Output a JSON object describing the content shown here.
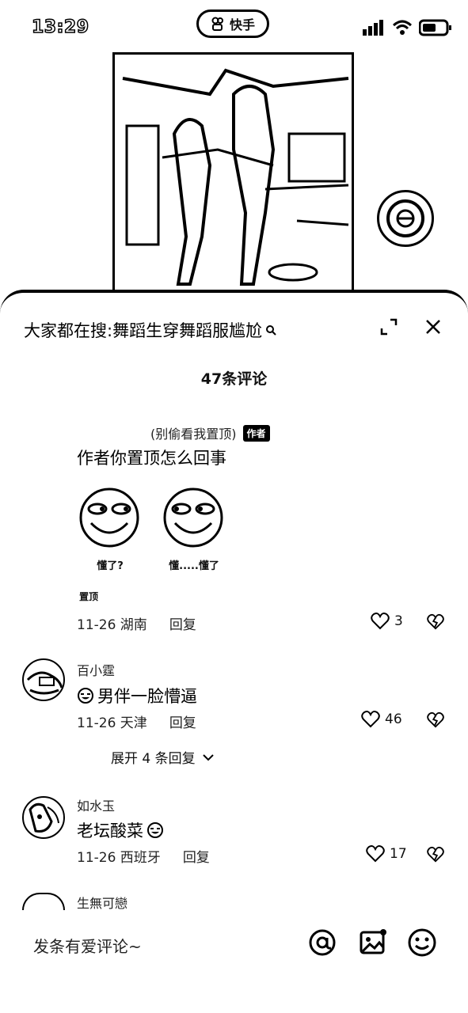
{
  "status_bar": {
    "time": "13:29",
    "app_label": "快手"
  },
  "sheet": {
    "search_title": "大家都在搜:舞蹈生穿舞蹈服尴尬",
    "comment_count": "47条评论"
  },
  "pinned_comment": {
    "user": "(别偷看我置顶)",
    "badge": "作者",
    "text": "作者你置顶怎么回事",
    "stickers": [
      {
        "caption": "懂了?"
      },
      {
        "caption": "懂.....懂了"
      }
    ],
    "pinned_label": "置顶",
    "date_location": "11-26 湖南",
    "reply": "回复",
    "likes": "3"
  },
  "comments": [
    {
      "user": "百小霆",
      "text": "男伴一脸懵逼",
      "date_location": "11-26 天津",
      "reply": "回复",
      "likes": "46",
      "expand": "展开 4 条回复"
    },
    {
      "user": "如水玉",
      "text": "老坛酸菜",
      "date_location": "11-26 西班牙",
      "reply": "回复",
      "likes": "17"
    },
    {
      "user": "生無可戀"
    }
  ],
  "input": {
    "placeholder": "发条有爱评论~"
  }
}
